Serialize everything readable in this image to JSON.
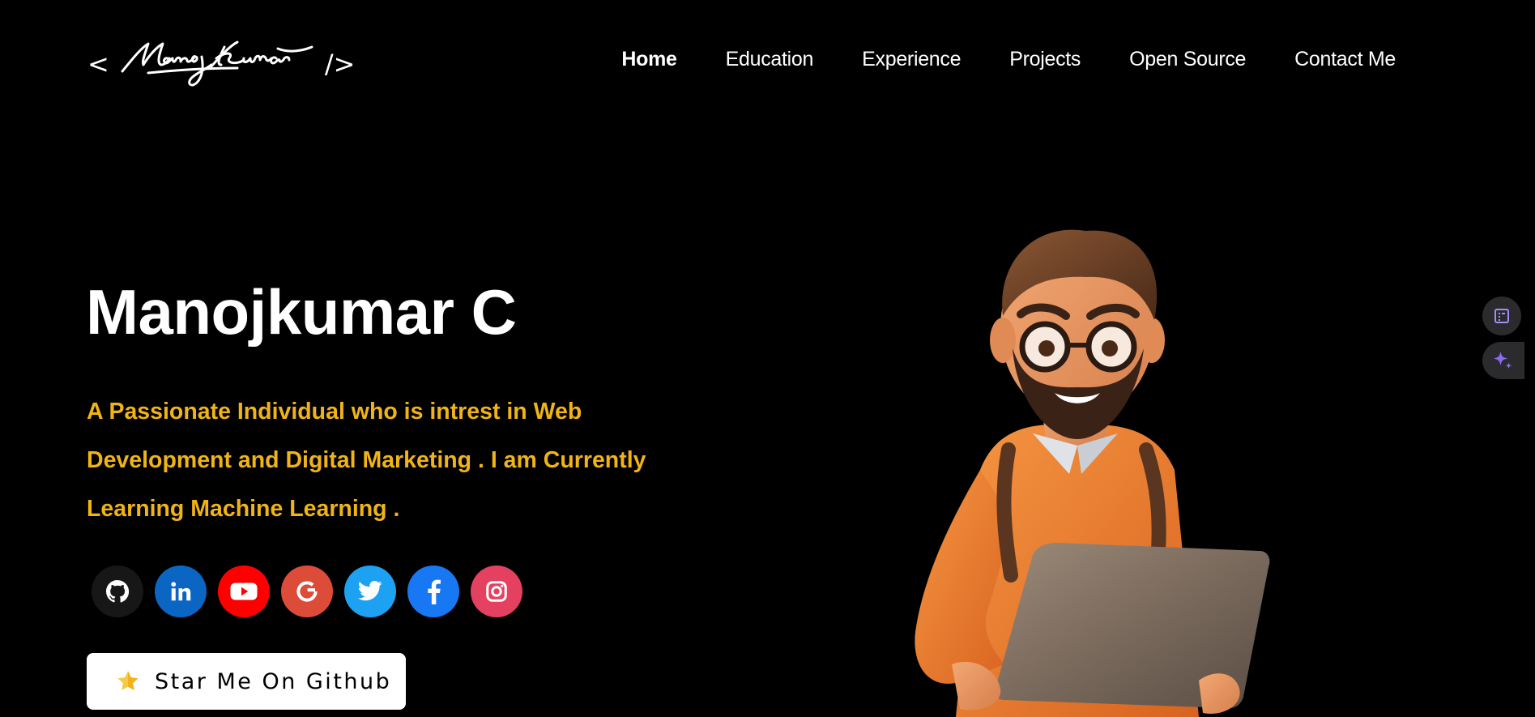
{
  "logo": {
    "open": "<",
    "signature": "Manoj Kumar",
    "close": "/>"
  },
  "nav": {
    "items": [
      {
        "label": "Home",
        "active": true
      },
      {
        "label": "Education",
        "active": false
      },
      {
        "label": "Experience",
        "active": false
      },
      {
        "label": "Projects",
        "active": false
      },
      {
        "label": "Open Source",
        "active": false
      },
      {
        "label": "Contact Me",
        "active": false
      }
    ]
  },
  "hero": {
    "title": "Manojkumar C",
    "subtitle_lines": [
      "A Passionate Individual who is intrest in Web",
      "Development and Digital Marketing . I am Currently",
      "Learning Machine Learning ."
    ]
  },
  "socials": [
    {
      "name": "github-icon",
      "color": "#181717"
    },
    {
      "name": "linkedin-icon",
      "color": "#0a66c2"
    },
    {
      "name": "youtube-icon",
      "color": "#ff0000"
    },
    {
      "name": "google-icon",
      "color": "#dd4b39"
    },
    {
      "name": "twitter-icon",
      "color": "#1da1f2"
    },
    {
      "name": "facebook-icon",
      "color": "#1877f2"
    },
    {
      "name": "instagram-icon",
      "color": "#e4405f"
    }
  ],
  "cta": {
    "label": "Star Me On Github",
    "icon": "star-icon"
  },
  "colors": {
    "background": "#000000",
    "accent": "#f0b416",
    "text": "#ffffff"
  },
  "side_buttons": [
    {
      "icon": "document-icon"
    },
    {
      "icon": "sparkle-icon"
    }
  ]
}
